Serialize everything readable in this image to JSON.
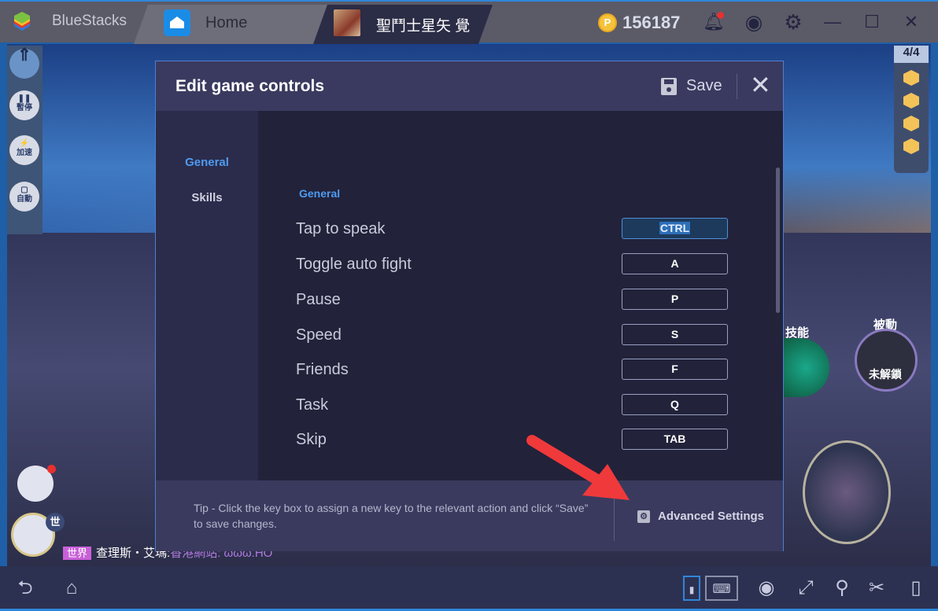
{
  "titlebar": {
    "brand": "BlueStacks",
    "tabs": [
      {
        "label": "Home",
        "icon": "home-icon"
      },
      {
        "label": "聖鬥士星矢 覺",
        "icon": "game-icon"
      }
    ],
    "coins": "156187",
    "icons": [
      "bell-icon",
      "account-icon",
      "gear-icon",
      "minimize-icon",
      "maximize-icon",
      "close-icon"
    ]
  },
  "game": {
    "left_buttons": [
      "暫停",
      "加速",
      "自動"
    ],
    "counter": "4/4",
    "skill_label": "技能",
    "passive_label": "被動",
    "passive_status": "未解鎖",
    "chat_badge": "世",
    "chat_channel": "世界",
    "chat_name": "查理斯・艾瑪:",
    "chat_message": "香港網站: ωωω.HO"
  },
  "dialog": {
    "title": "Edit game controls",
    "save_label": "Save",
    "sidebar": [
      {
        "label": "General",
        "active": true
      },
      {
        "label": "Skills",
        "active": false
      }
    ],
    "section_title": "General",
    "controls": [
      {
        "action": "Tap to speak",
        "key": "CTRL",
        "selected": true
      },
      {
        "action": "Toggle auto fight",
        "key": "A"
      },
      {
        "action": "Pause",
        "key": "P"
      },
      {
        "action": "Speed",
        "key": "S"
      },
      {
        "action": "Friends",
        "key": "F"
      },
      {
        "action": "Task",
        "key": "Q"
      },
      {
        "action": "Skip",
        "key": "TAB"
      }
    ],
    "tip": "Tip - Click the key box to assign a new key to the relevant action and click “Save” to save changes.",
    "advanced_settings": "Advanced Settings"
  },
  "bottombar": {
    "icons": [
      "back-icon",
      "home-icon",
      "game-controls-icon",
      "keyboard-icon",
      "eye-icon",
      "fullscreen-icon",
      "location-icon",
      "scissors-icon",
      "rotate-icon"
    ]
  },
  "colors": {
    "accent": "#4e9bef",
    "dialog_bg": "#22223a",
    "header_bg": "#3a3a60",
    "arrow": "#f0393b"
  }
}
